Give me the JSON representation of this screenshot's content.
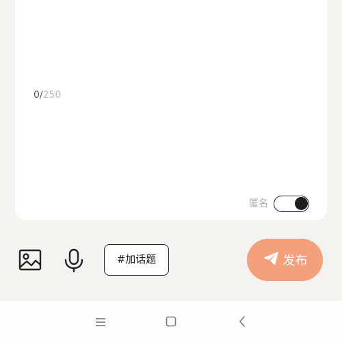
{
  "editor": {
    "char_count": "0",
    "char_separator": "/",
    "char_max": "250"
  },
  "anonymous": {
    "label": "匿名",
    "enabled": true
  },
  "toolbar": {
    "image_icon": "image-icon",
    "mic_icon": "microphone-icon",
    "topic_label": "#加话题",
    "publish_label": "发布",
    "publish_icon": "paper-plane-icon",
    "publish_color": "#f3a07b"
  },
  "system_nav": {
    "menu_icon": "menu-icon",
    "home_icon": "home-icon",
    "back_icon": "back-icon"
  }
}
